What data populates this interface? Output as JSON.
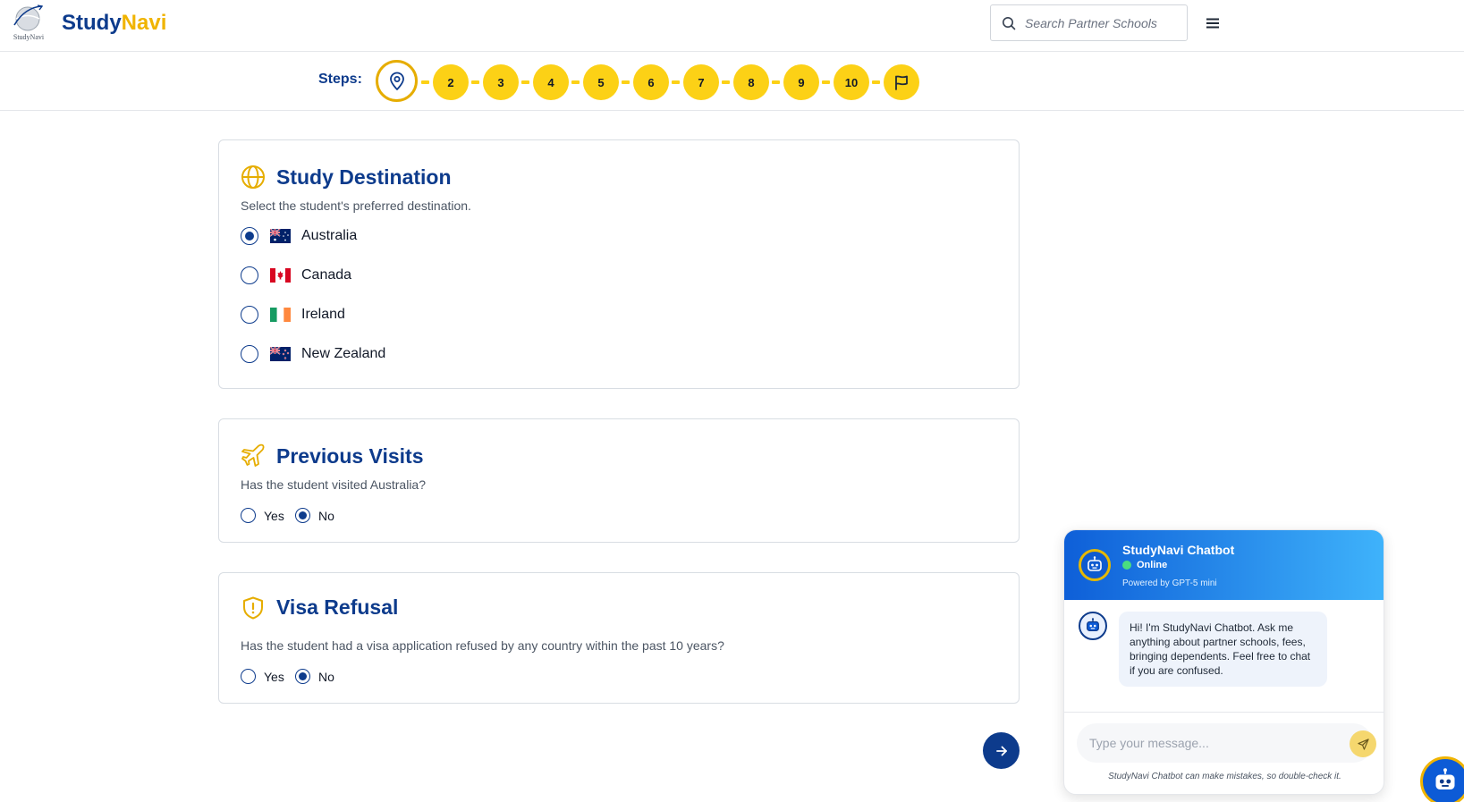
{
  "header": {
    "logo_text": "StudyNavi",
    "brand_part1": "Study",
    "brand_part2": "Navi",
    "search_placeholder": "Search Partner Schools",
    "search_icon": "search-icon",
    "menu_icon": "hamburger-menu-icon"
  },
  "steps": {
    "label": "Steps:",
    "current_icon": "map-pin-icon",
    "items": [
      "2",
      "3",
      "4",
      "5",
      "6",
      "7",
      "8",
      "9",
      "10"
    ],
    "final_icon": "flag-icon"
  },
  "destination": {
    "title": "Study Destination",
    "icon": "globe-icon",
    "description": "Select the student's preferred destination.",
    "options": [
      {
        "label": "Australia",
        "flag": "australia-flag",
        "selected": true
      },
      {
        "label": "Canada",
        "flag": "canada-flag",
        "selected": false
      },
      {
        "label": "Ireland",
        "flag": "ireland-flag",
        "selected": false
      },
      {
        "label": "New Zealand",
        "flag": "new-zealand-flag",
        "selected": false
      }
    ]
  },
  "visits": {
    "title": "Previous Visits",
    "icon": "plane-icon",
    "question": "Has the student visited Australia?",
    "yes_label": "Yes",
    "no_label": "No",
    "selected": "No"
  },
  "refusal": {
    "title": "Visa Refusal",
    "icon": "shield-alert-icon",
    "question": "Has the student had a visa application refused by any country within the past 10 years?",
    "yes_label": "Yes",
    "no_label": "No",
    "selected": "No"
  },
  "next_icon": "arrow-right-icon",
  "chatbot": {
    "name": "StudyNavi Chatbot",
    "status": "Online",
    "powered_by": "Powered by GPT-5 mini",
    "greeting": "Hi! I'm StudyNavi Chatbot. Ask me anything about partner schools, fees, bringing dependents. Feel free to chat if you are confused.",
    "input_placeholder": "Type your message...",
    "disclaimer": "StudyNavi Chatbot can make mistakes, so double-check it.",
    "send_icon": "send-icon",
    "avatar_icon": "robot-icon"
  },
  "colors": {
    "primary": "#0d3b8c",
    "accent": "#fcd116",
    "accent_dark": "#e6ad00",
    "chat_gradient_start": "#0e5fd8",
    "chat_gradient_end": "#3fb3fb"
  }
}
